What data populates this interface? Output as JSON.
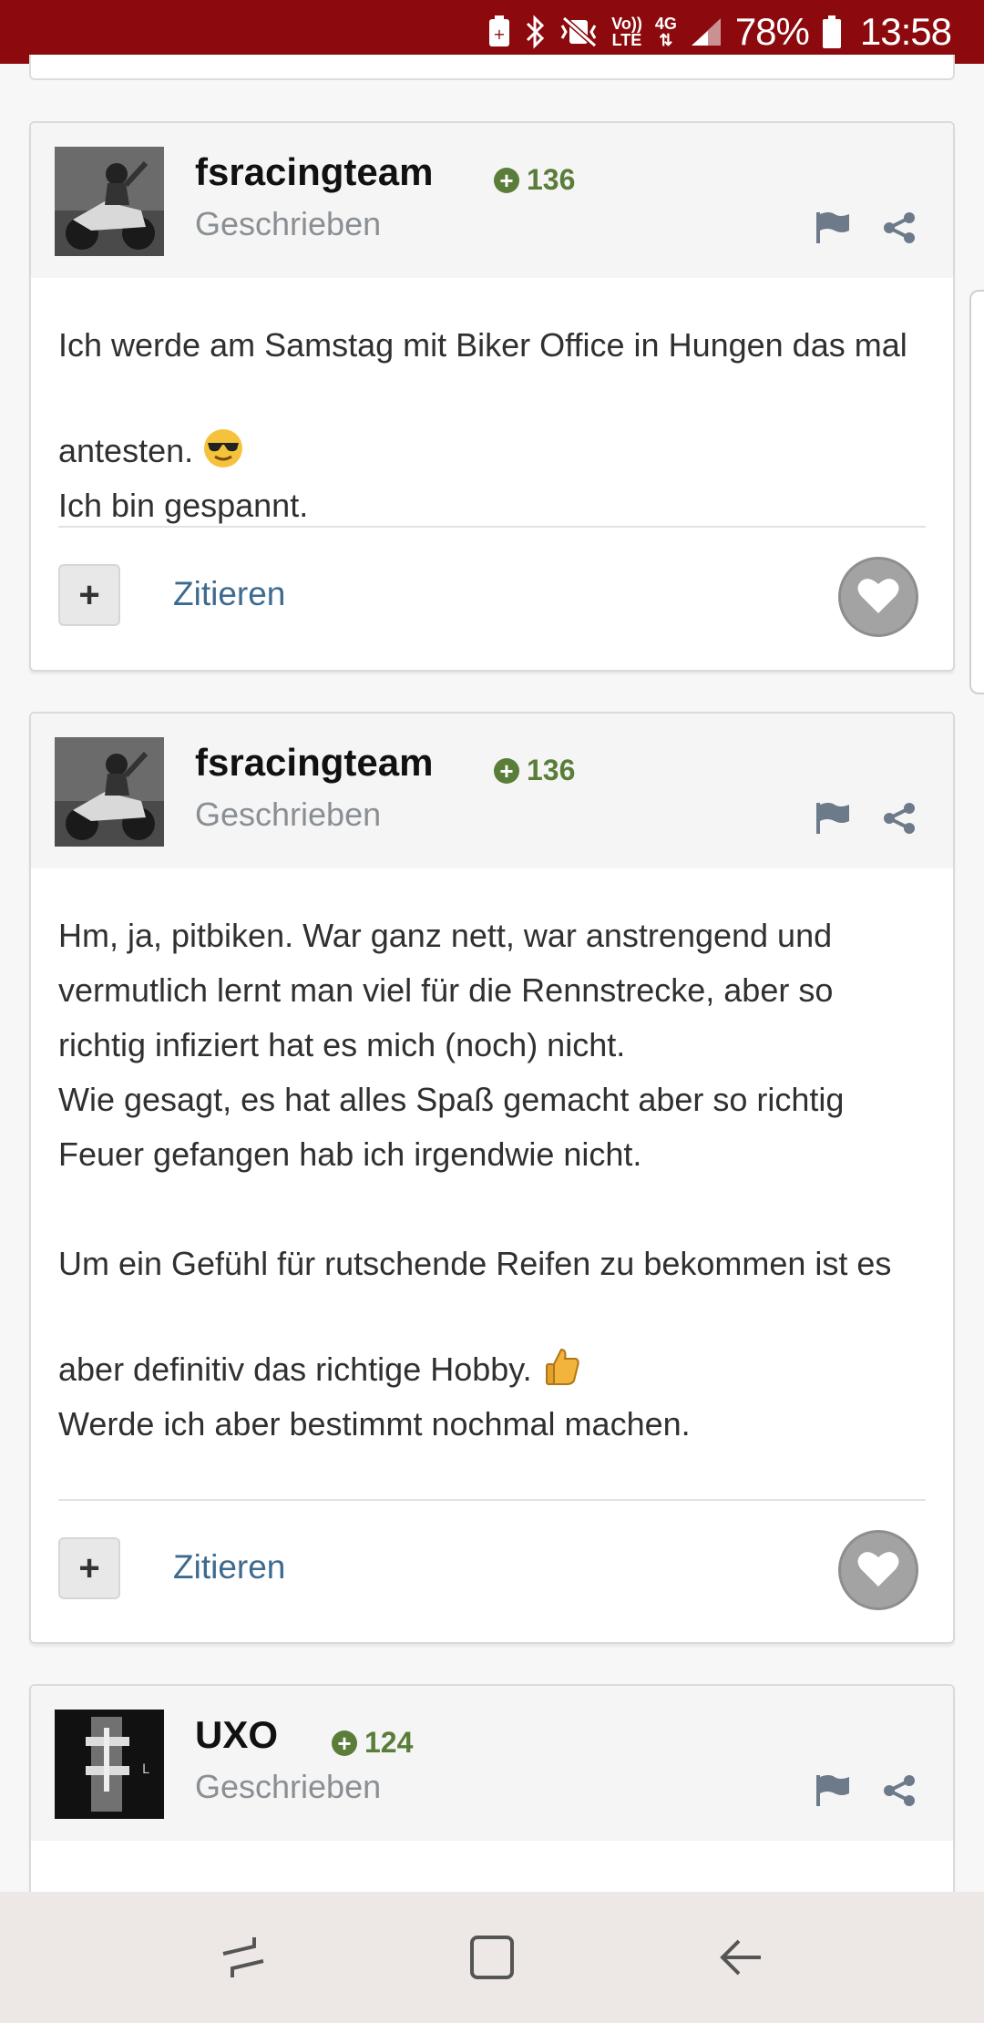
{
  "statusbar": {
    "volte_top": "Vo))",
    "volte_bottom": "LTE",
    "network": "4G",
    "battery_percent": "78%",
    "time": "13:58"
  },
  "posts": [
    {
      "username": "fsracingteam",
      "reputation": "136",
      "written_label": "Geschrieben",
      "body": [
        "Ich werde am Samstag mit Biker Office in Hungen das mal antesten.",
        "Ich bin gespannt."
      ],
      "quote_label": "Zitieren",
      "plus_label": "+"
    },
    {
      "username": "fsracingteam",
      "reputation": "136",
      "written_label": "Geschrieben",
      "body": [
        "Hm, ja, pitbiken. War ganz nett, war anstrengend und vermutlich lernt man viel für die Rennstrecke, aber so richtig infiziert hat es mich (noch) nicht.\nWie gesagt, es hat alles Spaß gemacht aber so richtig Feuer gefangen hab ich irgendwie nicht.",
        "Um ein Gefühl für rutschende Reifen zu bekommen ist es aber definitiv das richtige Hobby.",
        "Werde ich aber bestimmt nochmal machen."
      ],
      "quote_label": "Zitieren",
      "plus_label": "+"
    },
    {
      "username": "UXO",
      "reputation": "124",
      "written_label": "Geschrieben"
    }
  ],
  "icons": {
    "flag": "flag-icon",
    "share": "share-icon",
    "like": "heart-icon",
    "emoji_cool": "sunglasses-emoji",
    "emoji_thumb": "thumbs-up-emoji"
  },
  "colors": {
    "statusbar": "#8c0a0e",
    "reputation": "#5a7d39",
    "link": "#3d6a8f"
  }
}
